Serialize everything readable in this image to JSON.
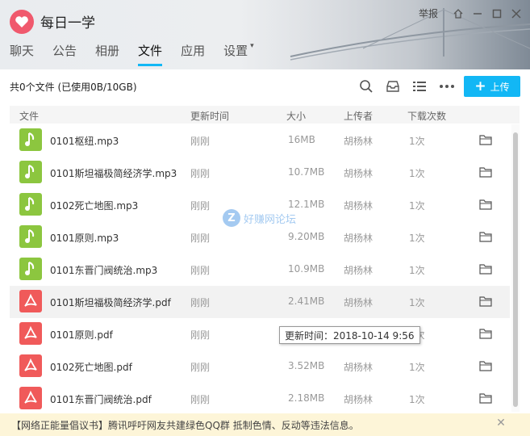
{
  "window": {
    "group_name": "每日一学",
    "report_label": "举报",
    "tabs": [
      "聊天",
      "公告",
      "相册",
      "文件",
      "应用",
      "设置"
    ],
    "active_tab": "文件"
  },
  "toolbar": {
    "summary": "共0个文件 (已使用0B/10GB)",
    "upload_label": "上传",
    "accent": "#12b7f5"
  },
  "columns": {
    "file": "文件",
    "time": "更新时间",
    "size": "大小",
    "uploader": "上传者",
    "downloads": "下载次数"
  },
  "files": [
    {
      "name": "0101枢纽.mp3",
      "time": "刚刚",
      "size": "16MB",
      "uploader": "胡杨林",
      "downloads": "1次",
      "type": "audio"
    },
    {
      "name": "0101斯坦福极简经济学.mp3",
      "time": "刚刚",
      "size": "10.7MB",
      "uploader": "胡杨林",
      "downloads": "1次",
      "type": "audio"
    },
    {
      "name": "0102死亡地图.mp3",
      "time": "刚刚",
      "size": "12.1MB",
      "uploader": "胡杨林",
      "downloads": "1次",
      "type": "audio"
    },
    {
      "name": "0101原则.mp3",
      "time": "刚刚",
      "size": "9.20MB",
      "uploader": "胡杨林",
      "downloads": "1次",
      "type": "audio"
    },
    {
      "name": "0101东晋门阀统治.mp3",
      "time": "刚刚",
      "size": "10.9MB",
      "uploader": "胡杨林",
      "downloads": "1次",
      "type": "audio"
    },
    {
      "name": "0101斯坦福极简经济学.pdf",
      "time": "刚刚",
      "size": "2.41MB",
      "uploader": "胡杨林",
      "downloads": "1次",
      "type": "pdf"
    },
    {
      "name": "0101原则.pdf",
      "time": "刚刚",
      "size": "",
      "uploader": "",
      "downloads": "1次",
      "type": "pdf"
    },
    {
      "name": "0102死亡地图.pdf",
      "time": "刚刚",
      "size": "3.52MB",
      "uploader": "胡杨林",
      "downloads": "1次",
      "type": "pdf"
    },
    {
      "name": "0101东晋门阀统治.pdf",
      "time": "刚刚",
      "size": "2.18MB",
      "uploader": "胡杨林",
      "downloads": "1次",
      "type": "pdf"
    },
    {
      "name": "0101枢纽.pdf",
      "time": "刚刚",
      "size": "5.63MB",
      "uploader": "胡杨林",
      "downloads": "1次",
      "type": "pdf"
    }
  ],
  "hover_row": 5,
  "tooltip": "更新时间：2018-10-14 9:56",
  "watermark": "好赚网论坛",
  "notice": {
    "text": "【网络正能量倡议书】腾讯呼吁网友共建绿色QQ群 抵制色情、反动等违法信息。",
    "close": "✕"
  },
  "icon_colors": {
    "audio": "#8cc63f",
    "pdf": "#f05a5a",
    "logo": "#f0596d"
  }
}
